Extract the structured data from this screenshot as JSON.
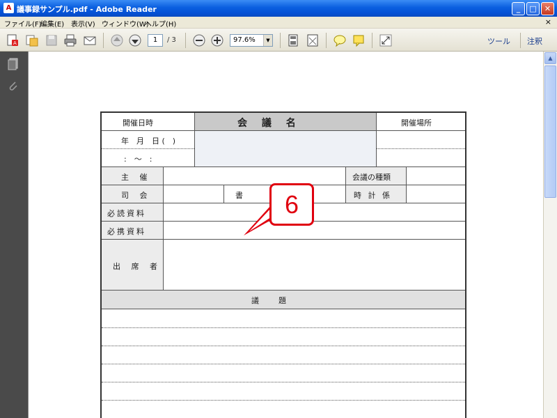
{
  "window": {
    "title": "議事録サンプル.pdf - Adobe Reader",
    "app_icon": "pdf-icon",
    "buttons": {
      "minimize": "_",
      "maximize": "□",
      "close": "✕"
    }
  },
  "menu": {
    "items": [
      "ファイル(F)",
      "編集(E)",
      "表示(V)",
      "ウィンドウ(W)",
      "ヘルプ(H)"
    ],
    "close_glyph": "×"
  },
  "toolbar": {
    "current_page": "1",
    "page_total": "/ 3",
    "zoom": "97.6%",
    "tools_label": "ツール",
    "comment_label": "注釈"
  },
  "form": {
    "header_date": "開催日時",
    "header_meeting_name": "会 議 名",
    "header_place": "開催場所",
    "date_line": "年　月　日 (　)",
    "time_line": ":　〜　:",
    "organizer": "主 催",
    "meeting_type": "会議の種類",
    "chair": "司 会",
    "recorder": "書",
    "timekeeper": "時 計 係",
    "required_materials": "必読資料",
    "bring_materials": "必携資料",
    "attendees": "出 席 者",
    "agenda": "議　　題"
  },
  "callout": {
    "number": "6"
  },
  "colors": {
    "titlebar": "#0a5fe0",
    "callout": "#e0000f",
    "sidebar": "#4a4a4a"
  }
}
